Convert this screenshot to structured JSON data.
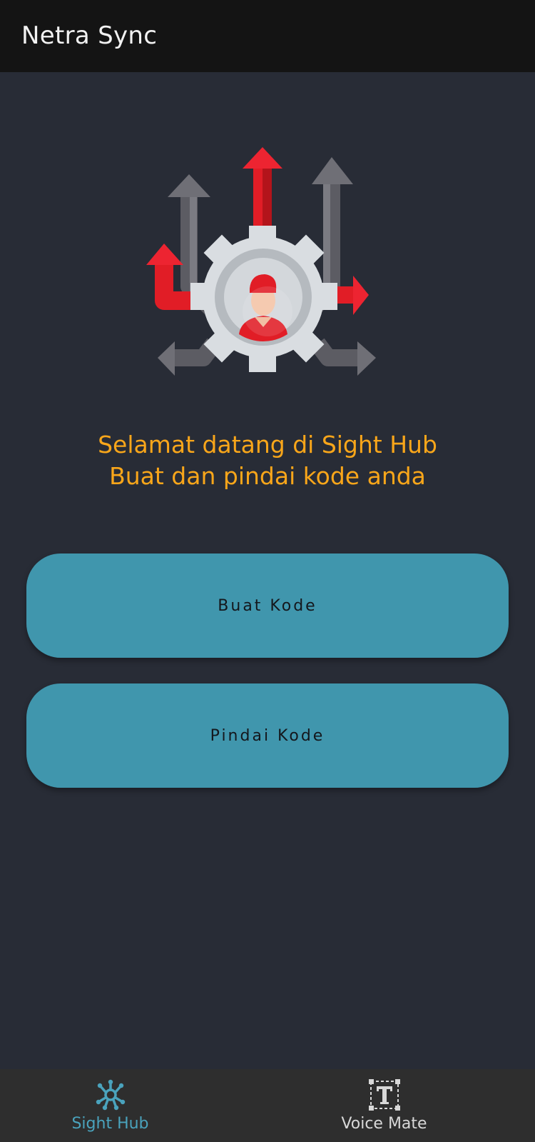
{
  "app_bar": {
    "title": "Netra Sync"
  },
  "hero": {
    "illustration": "gear-with-person-and-arrows-icon"
  },
  "welcome": {
    "line1": "Selamat datang di Sight Hub",
    "line2": "Buat dan pindai kode anda"
  },
  "actions": {
    "create_label": "Buat Kode",
    "scan_label": "Pindai Kode"
  },
  "bottom_nav": {
    "items": [
      {
        "label": "Sight Hub",
        "icon": "hub-icon",
        "active": true
      },
      {
        "label": "Voice Mate",
        "icon": "text-icon",
        "active": false
      }
    ]
  },
  "colors": {
    "background": "#282c36",
    "app_bar": "#141414",
    "accent_text": "#f9a61a",
    "button": "#4096ad",
    "nav_active": "#4aa3bd",
    "nav_inactive": "#d8d8d8"
  }
}
